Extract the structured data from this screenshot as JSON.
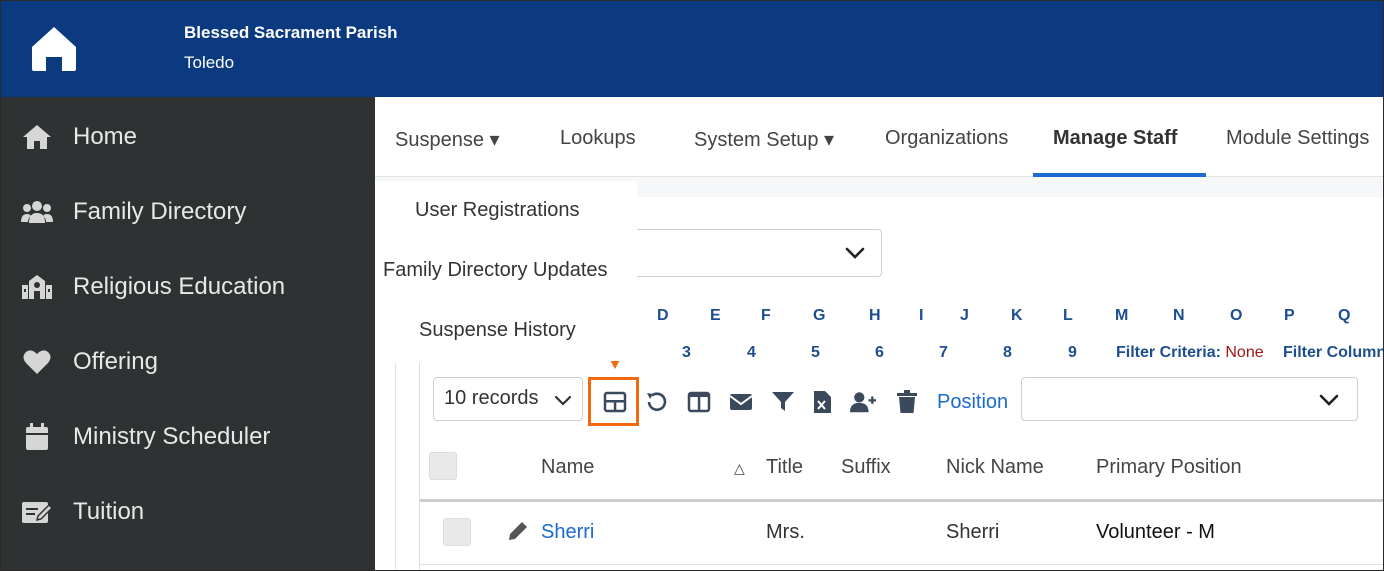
{
  "header": {
    "parish_name": "Blessed Sacrament Parish",
    "parish_city": "Toledo",
    "logo_icon": "home-icon",
    "background_color": "#0b3a80"
  },
  "sidebar": {
    "background_color": "#2e3233",
    "items": [
      {
        "label": "Home",
        "icon": "home-icon"
      },
      {
        "label": "Family Directory",
        "icon": "users-icon"
      },
      {
        "label": "Religious Education",
        "icon": "school-icon"
      },
      {
        "label": "Offering",
        "icon": "heart-icon"
      },
      {
        "label": "Ministry Scheduler",
        "icon": "calendar-icon"
      },
      {
        "label": "Tuition",
        "icon": "edit-icon"
      }
    ]
  },
  "tabs": [
    {
      "label": "Suspense ▾"
    },
    {
      "label": "Lookups"
    },
    {
      "label": "System Setup ▾"
    },
    {
      "label": "Organizations"
    },
    {
      "label": "Manage Staff",
      "active": true
    },
    {
      "label": "Module Settings"
    }
  ],
  "suspense_menu": {
    "items": [
      {
        "label": "User Registrations"
      },
      {
        "label": "Family Directory Updates"
      },
      {
        "label": "Suspense History"
      }
    ]
  },
  "alphabet_row": [
    "D",
    "E",
    "F",
    "G",
    "H",
    "I",
    "J",
    "K",
    "L",
    "M",
    "N",
    "O",
    "P",
    "Q"
  ],
  "number_row": [
    "3",
    "4",
    "5",
    "6",
    "7",
    "8",
    "9"
  ],
  "filter": {
    "criteria_label": "Filter Criteria:",
    "criteria_value": "None",
    "column_label": "Filter Column"
  },
  "toolbar": {
    "records_value": "10 records",
    "icons": [
      "table-layout-icon",
      "undo-icon",
      "columns-icon",
      "email-icon",
      "filter-icon",
      "excel-export-icon",
      "add-user-icon",
      "trash-icon"
    ],
    "position_label": "Position",
    "position_value": "",
    "highlight_color": "#f26a10"
  },
  "table": {
    "columns": [
      "Name",
      "Title",
      "Suffix",
      "Nick Name",
      "Primary Position"
    ],
    "sort_indicator": "△",
    "rows": [
      {
        "name": "Sherri",
        "title": "Mrs.",
        "suffix": "",
        "nick_name": "Sherri",
        "primary_position": "Volunteer - M"
      }
    ]
  }
}
